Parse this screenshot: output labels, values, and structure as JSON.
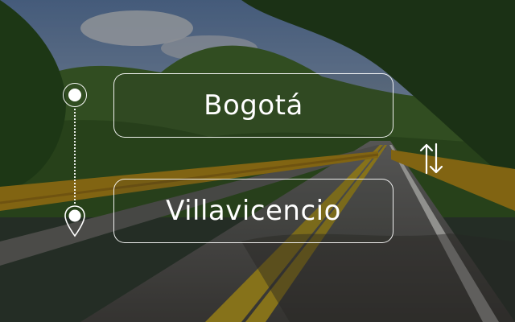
{
  "route": {
    "origin": {
      "value": "Bogotá",
      "icon": "origin-circle-icon"
    },
    "destination": {
      "value": "Villavicencio",
      "icon": "map-pin-icon"
    },
    "swap_icon": "swap-vertical-icon"
  },
  "colors": {
    "overlay": "#000000",
    "text": "#ffffff",
    "outline": "#ffffff"
  }
}
